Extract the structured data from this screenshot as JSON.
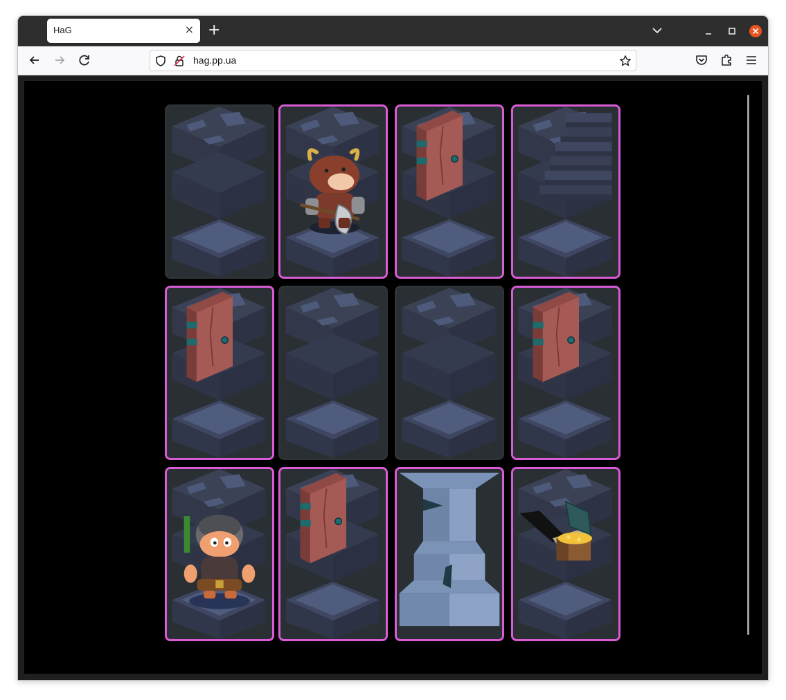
{
  "browser": {
    "tab_title": "HaG",
    "url": "hag.pp.ua",
    "new_tab_symbol": "+",
    "close_tab_symbol": "×"
  },
  "board": {
    "rows": 3,
    "cols": 4,
    "selected_border_color": "#d95bd6",
    "cards": [
      {
        "row": 0,
        "col": 0,
        "content": "floor",
        "highlighted": false
      },
      {
        "row": 0,
        "col": 1,
        "content": "minotaur-enemy",
        "highlighted": true
      },
      {
        "row": 0,
        "col": 2,
        "content": "door",
        "highlighted": true
      },
      {
        "row": 0,
        "col": 3,
        "content": "stairs",
        "highlighted": true
      },
      {
        "row": 1,
        "col": 0,
        "content": "door",
        "highlighted": true
      },
      {
        "row": 1,
        "col": 1,
        "content": "floor",
        "highlighted": false
      },
      {
        "row": 1,
        "col": 2,
        "content": "floor",
        "highlighted": false
      },
      {
        "row": 1,
        "col": 3,
        "content": "door",
        "highlighted": true
      },
      {
        "row": 2,
        "col": 0,
        "content": "hero",
        "highlighted": true,
        "health": 1.0
      },
      {
        "row": 2,
        "col": 1,
        "content": "door",
        "highlighted": true
      },
      {
        "row": 2,
        "col": 2,
        "content": "pillar",
        "highlighted": true
      },
      {
        "row": 2,
        "col": 3,
        "content": "treasure-chest",
        "highlighted": true
      }
    ]
  }
}
